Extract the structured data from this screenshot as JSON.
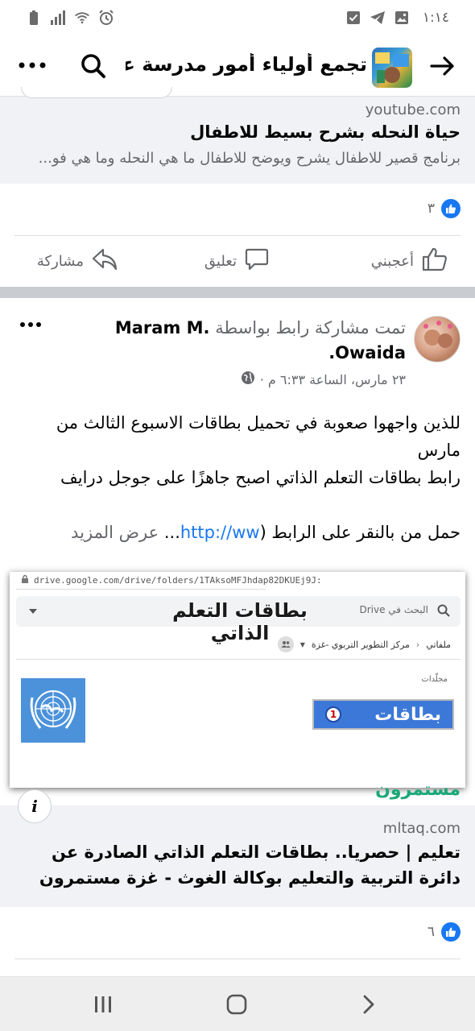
{
  "status_bar": {
    "time": "١:١٤",
    "icons_left": [
      "battery-icon",
      "signal-icon",
      "wifi-icon",
      "alarm-icon"
    ],
    "icons_right": [
      "checkbox-icon",
      "telegram-icon",
      "gallery-icon"
    ]
  },
  "header": {
    "title": "تجمع أولياء أمور مدرسة عزب...",
    "icons": [
      "back-arrow-icon",
      "search-icon",
      "more-icon"
    ]
  },
  "shared_link_1": {
    "domain": "youtube.com",
    "title": "حياة النحله بشرح بسيط للاطفال",
    "description": "برنامج قصير للاطفال يشرح ويوضح للاطفال ما هي النحله وما هي فو..."
  },
  "reactions_1": {
    "count": "٣"
  },
  "actions": {
    "like": "أعجبني",
    "comment": "تعليق",
    "share": "مشاركة"
  },
  "post_2": {
    "author": "Maram M. Owaida.",
    "verb": "تمت مشاركة رابط بواسطة",
    "meta": "٢٣ مارس، الساعة ٦:٣٣ م ·",
    "body_lines": [
      "للذين واجهوا صعوبة في تحميل بطاقات الاسبوع الثالث من مارس",
      "رابط بطاقات التعلم الذاتي اصبح جاهزًا على جوجل درايف",
      ""
    ],
    "last_line_prefix": "حمل من بالنقر على الرابط (",
    "link_fragment": "http://ww",
    "ellipsis": "...",
    "see_more": "عرض المزيد"
  },
  "image_preview": {
    "url": "drive.google.com/drive/folders/1TAksoMFJhdap82DKUEj9J:",
    "search_placeholder": "البحث في Drive",
    "overlay_title": "بطاقات التعلم الذاتي",
    "breadcrumb_root": "ملفاتي",
    "breadcrumb_folder": "مركز التطوير التربوي -غزة",
    "folders_label": "مجلّدات",
    "card_text": "بطاقات",
    "card_number": "1",
    "watermark": "مستمرون"
  },
  "shared_link_2": {
    "domain": "mltaq.com",
    "title": "تعليم | حصريا.. بطاقات التعلم الذاتي الصادرة عن دائرة التربية والتعليم بوكالة الغوث - غزة مستمرون"
  },
  "reactions_2": {
    "count": "٦"
  },
  "nav": {
    "icons": [
      "recent-apps-icon",
      "home-icon",
      "back-icon"
    ]
  },
  "colors": {
    "accent": "#1877f2",
    "secondary_text": "#65676b",
    "separator": "#c9ccd1"
  }
}
